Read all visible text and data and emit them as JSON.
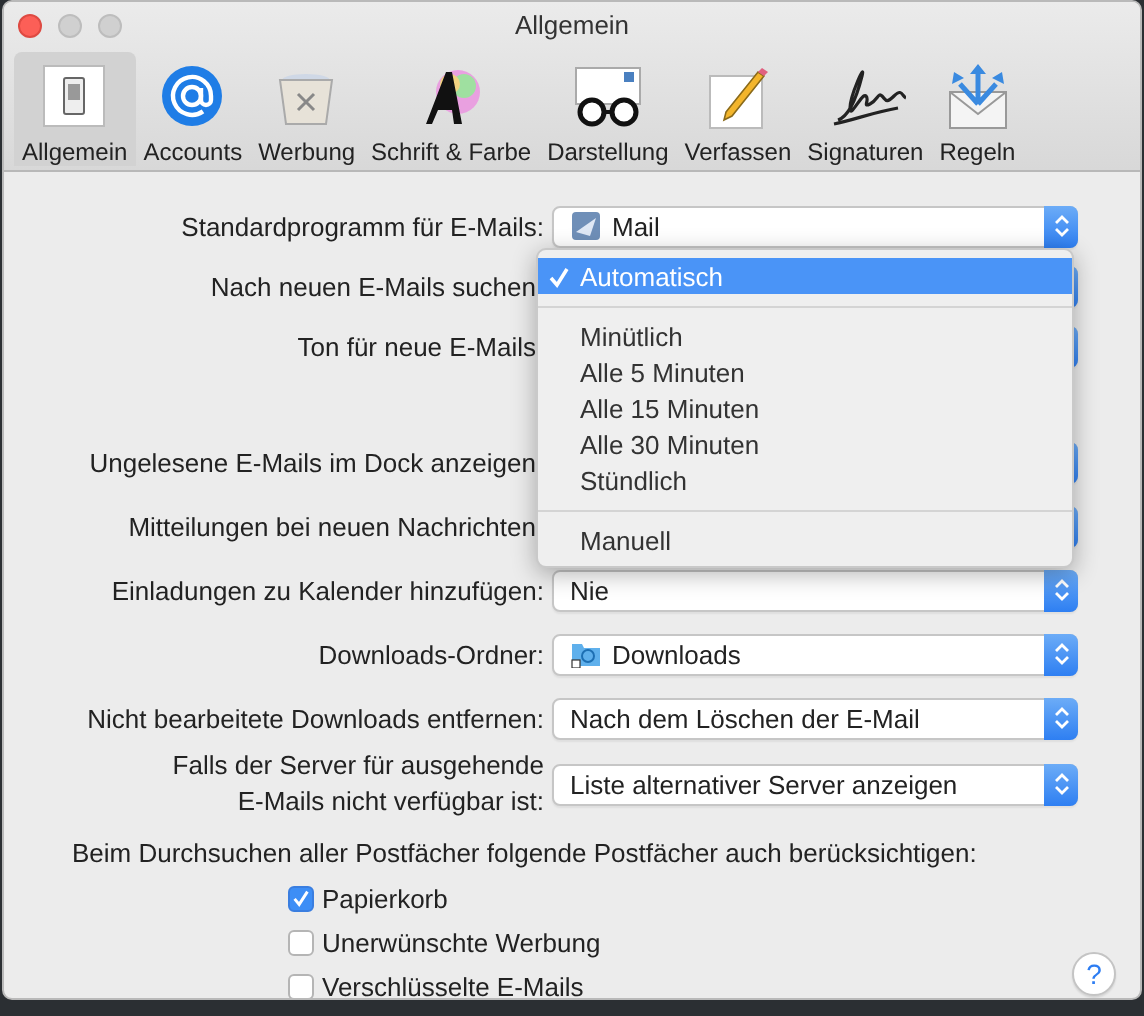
{
  "window": {
    "title": "Allgemein"
  },
  "toolbar": [
    {
      "label": "Allgemein",
      "selected": true
    },
    {
      "label": "Accounts",
      "selected": false
    },
    {
      "label": "Werbung",
      "selected": false
    },
    {
      "label": "Schrift & Farbe",
      "selected": false
    },
    {
      "label": "Darstellung",
      "selected": false
    },
    {
      "label": "Verfassen",
      "selected": false
    },
    {
      "label": "Signaturen",
      "selected": false
    },
    {
      "label": "Regeln",
      "selected": false
    }
  ],
  "settings": [
    {
      "kind": "app-popup",
      "label": "Standardprogramm für E-Mails:",
      "value": "Mail"
    },
    {
      "kind": "covered",
      "label": "Nach neuen E-Mails suchen"
    },
    {
      "kind": "covered",
      "label": "Ton für neue E-Mails"
    },
    {
      "kind": "covered",
      "label": "Ungelesene E-Mails im Dock anzeigen"
    },
    {
      "kind": "covered",
      "label": "Mitteilungen bei neuen Nachrichten"
    },
    {
      "kind": "popup",
      "label": "Einladungen zu Kalender hinzufügen:",
      "value": "Nie"
    },
    {
      "kind": "folder-popup",
      "label": "Downloads-Ordner:",
      "value": "Downloads"
    },
    {
      "kind": "popup",
      "label": "Nicht bearbeitete Downloads entfernen:",
      "value": "Nach dem Löschen der E-Mail"
    },
    {
      "kind": "popup",
      "label": "Falls der Server für ausgehende E-Mails nicht verfügbar ist:",
      "value": "Liste alternativer Server anzeigen"
    }
  ],
  "search_section": {
    "heading": "Beim Durchsuchen aller Postfächer folgende Postfächer auch berücksichtigen:",
    "options": [
      {
        "label": "Papierkorb",
        "checked": true
      },
      {
        "label": "Unerwünschte Werbung",
        "checked": false
      },
      {
        "label": "Verschlüsselte E-Mails",
        "checked": false
      }
    ]
  },
  "help_button": {
    "label": "?"
  },
  "open_menu": {
    "items": [
      {
        "kind": "item",
        "label": "Automatisch",
        "selected": true
      },
      {
        "kind": "separator"
      },
      {
        "kind": "item",
        "label": "Minütlich",
        "selected": false
      },
      {
        "kind": "item",
        "label": "Alle 5 Minuten",
        "selected": false
      },
      {
        "kind": "item",
        "label": "Alle 15 Minuten",
        "selected": false
      },
      {
        "kind": "item",
        "label": "Alle 30 Minuten",
        "selected": false
      },
      {
        "kind": "item",
        "label": "Stündlich",
        "selected": false
      },
      {
        "kind": "separator"
      },
      {
        "kind": "item",
        "label": "Manuell",
        "selected": false
      }
    ]
  }
}
